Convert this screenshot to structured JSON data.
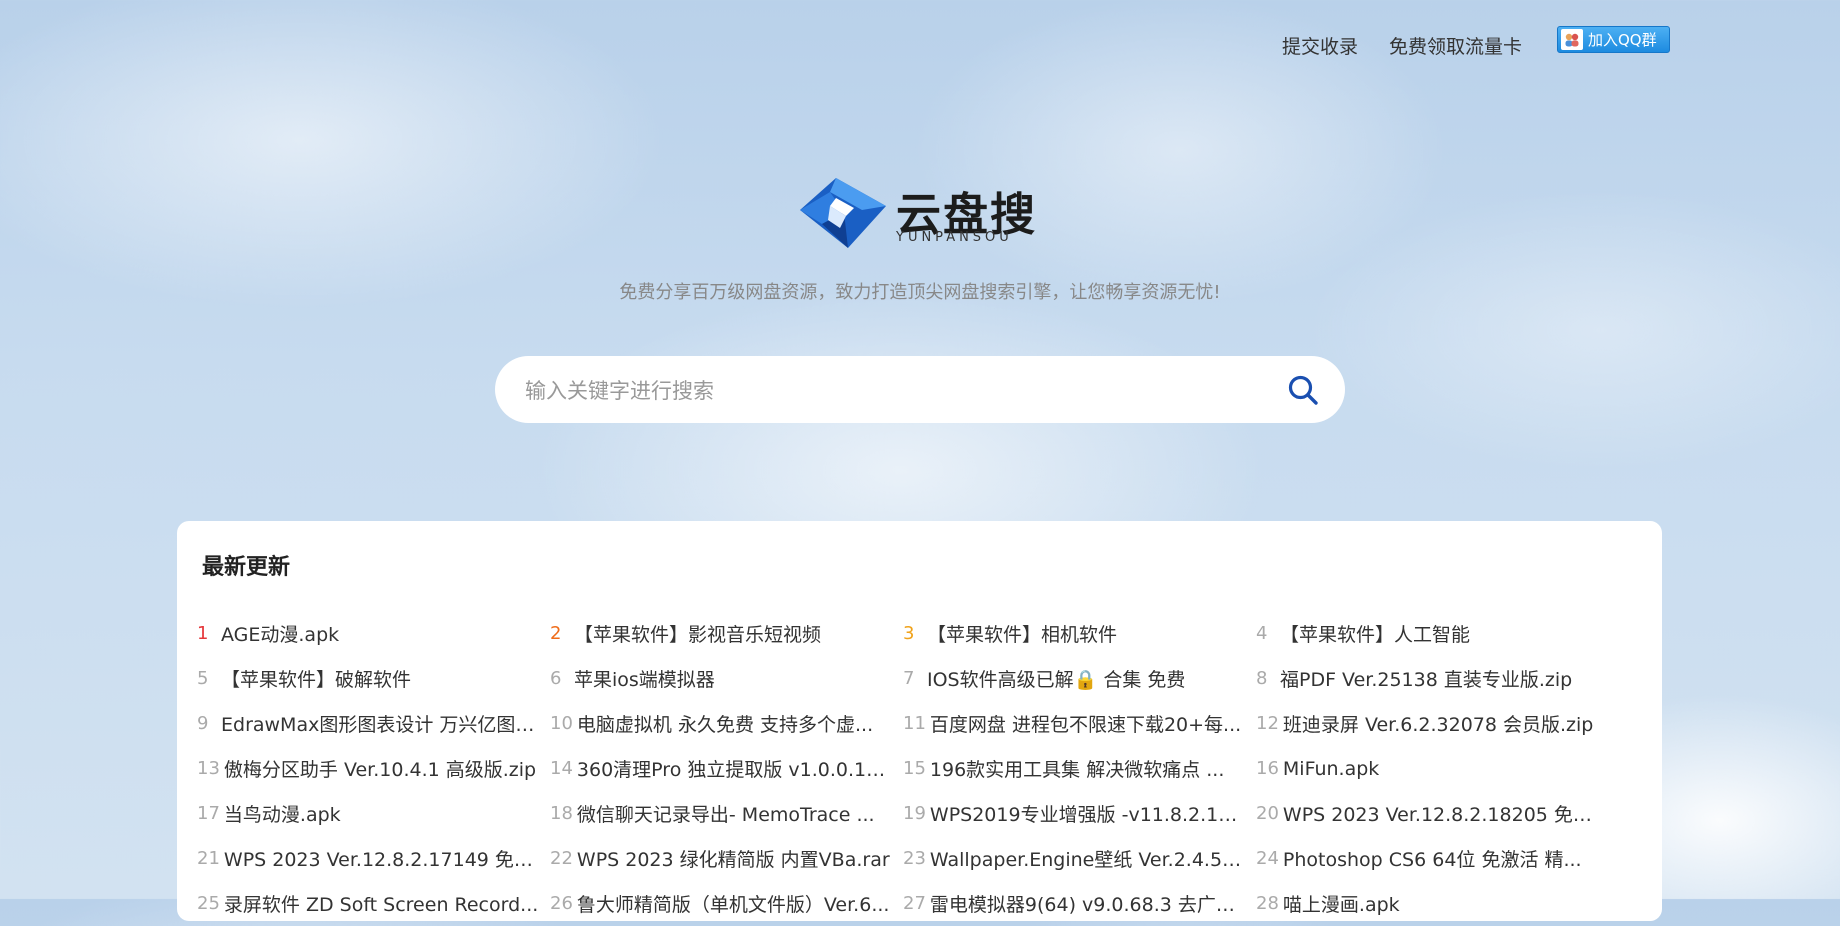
{
  "nav": {
    "submit_label": "提交收录",
    "card_label": "免费领取流量卡",
    "qq_label": "加入QQ群"
  },
  "logo": {
    "title": "云盘搜",
    "subtitle": "YUNPANSOU"
  },
  "tagline": "免费分享百万级网盘资源，致力打造顶尖网盘搜索引擎，让您畅享资源无忧!",
  "search": {
    "placeholder": "输入关键字进行搜索"
  },
  "latest": {
    "title": "最新更新",
    "items": [
      {
        "num": "1",
        "title": "AGE动漫.apk"
      },
      {
        "num": "2",
        "title": "【苹果软件】影视音乐短视频"
      },
      {
        "num": "3",
        "title": "【苹果软件】相机软件"
      },
      {
        "num": "4",
        "title": "【苹果软件】人工智能"
      },
      {
        "num": "5",
        "title": "【苹果软件】破解软件"
      },
      {
        "num": "6",
        "title": "苹果ios端模拟器"
      },
      {
        "num": "7",
        "title": "IOS软件高级已解🔒 合集 免费"
      },
      {
        "num": "8",
        "title": "福PDF Ver.25138 直装专业版.zip"
      },
      {
        "num": "9",
        "title": "EdrawMax图形图表设计 万兴亿图 ..."
      },
      {
        "num": "10",
        "title": "电脑虚拟机 永久免费 支持多个虚..."
      },
      {
        "num": "11",
        "title": "百度网盘 进程包不限速下载20+每..."
      },
      {
        "num": "12",
        "title": "班迪录屏 Ver.6.2.32078 会员版.zip"
      },
      {
        "num": "13",
        "title": "傲梅分区助手 Ver.10.4.1 高级版.zip"
      },
      {
        "num": "14",
        "title": "360清理Pro 独立提取版 v1.0.0.10..."
      },
      {
        "num": "15",
        "title": "196款实用工具集 解决微软痛点 ..."
      },
      {
        "num": "16",
        "title": "MiFun.apk"
      },
      {
        "num": "17",
        "title": "当鸟动漫.apk"
      },
      {
        "num": "18",
        "title": "微信聊天记录导出- MemoTrace ..."
      },
      {
        "num": "19",
        "title": "WPS2019专业增强版 -v11.8.2.12..."
      },
      {
        "num": "20",
        "title": "WPS 2023 Ver.12.8.2.18205 免激..."
      },
      {
        "num": "21",
        "title": "WPS 2023 Ver.12.8.2.17149 免激..."
      },
      {
        "num": "22",
        "title": "WPS 2023 绿化精简版 内置VBa.rar"
      },
      {
        "num": "23",
        "title": "Wallpaper.Engine壁纸 Ver.2.4.55..."
      },
      {
        "num": "24",
        "title": "Photoshop CS6 64位 免激活 精..."
      },
      {
        "num": "25",
        "title": "录屏软件 ZD Soft Screen Record..."
      },
      {
        "num": "26",
        "title": "鲁大师精简版（单机文件版）Ver.6..."
      },
      {
        "num": "27",
        "title": "雷电模拟器9(64) v9.0.68.3 去广告..."
      },
      {
        "num": "28",
        "title": "喵上漫画.apk"
      }
    ]
  },
  "colors": {
    "rank1": "#e5383b",
    "rank2": "#ef6c1a",
    "rank3": "#f0a21a",
    "brand_blue": "#1a5fc4"
  },
  "icons": {
    "search": "search-icon",
    "qq": "qq-icon",
    "logo": "logo-icon"
  }
}
